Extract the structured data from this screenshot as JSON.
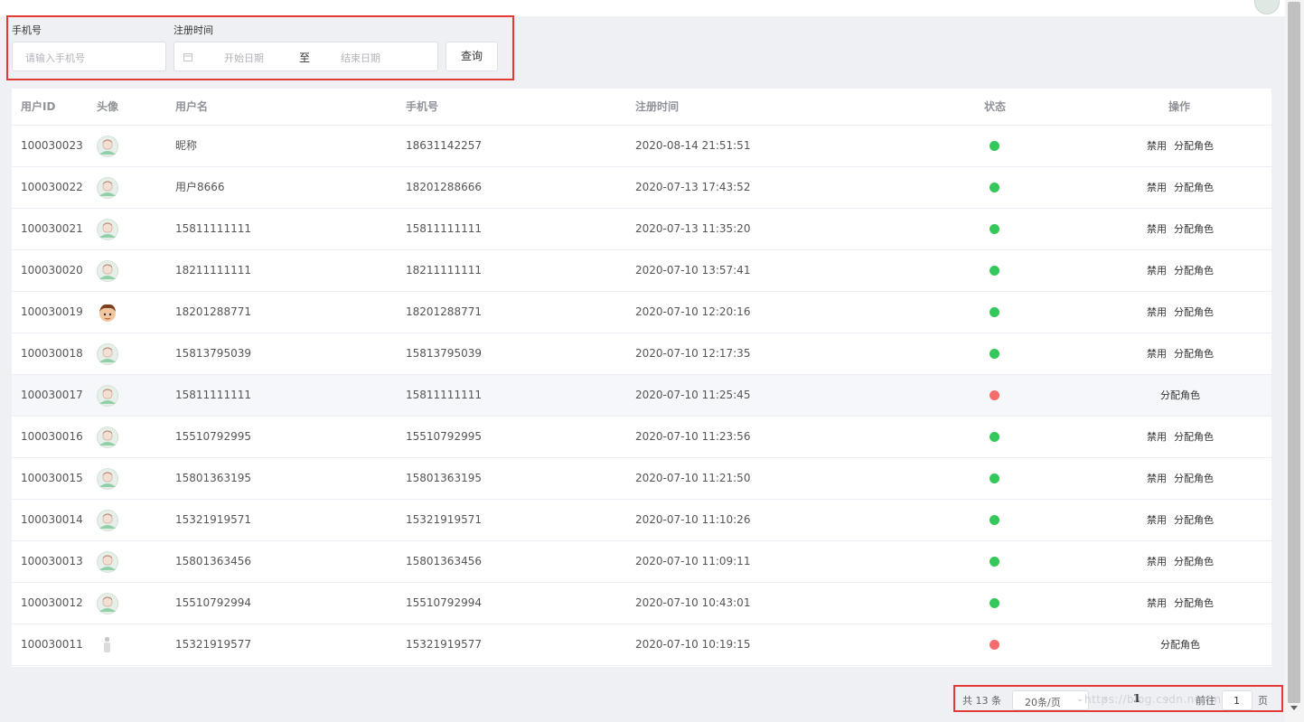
{
  "filters": {
    "phone_label": "手机号",
    "phone_placeholder": "请输入手机号",
    "date_label": "注册时间",
    "start_placeholder": "开始日期",
    "range_separator": "至",
    "end_placeholder": "结束日期",
    "query_button": "查询"
  },
  "table": {
    "headers": {
      "id": "用户ID",
      "avatar": "头像",
      "username": "用户名",
      "phone": "手机号",
      "reg_time": "注册时间",
      "status": "状态",
      "actions": "操作"
    },
    "rows": [
      {
        "id": "100030023",
        "username": "昵称",
        "phone": "18631142257",
        "reg_time": "2020-08-14 21:51:51",
        "avatar": "default",
        "status": "enabled",
        "status_color": "#34c759",
        "disable_label": "禁用",
        "assign_label": "分配角色"
      },
      {
        "id": "100030022",
        "username": "用户8666",
        "phone": "18201288666",
        "reg_time": "2020-07-13 17:43:52",
        "avatar": "default",
        "status": "enabled",
        "status_color": "#34c759",
        "disable_label": "禁用",
        "assign_label": "分配角色"
      },
      {
        "id": "100030021",
        "username": "15811111111",
        "phone": "15811111111",
        "reg_time": "2020-07-13 11:35:20",
        "avatar": "default",
        "status": "enabled",
        "status_color": "#34c759",
        "disable_label": "禁用",
        "assign_label": "分配角色"
      },
      {
        "id": "100030020",
        "username": "18211111111",
        "phone": "18211111111",
        "reg_time": "2020-07-10 13:57:41",
        "avatar": "default",
        "status": "enabled",
        "status_color": "#34c759",
        "disable_label": "禁用",
        "assign_label": "分配角色"
      },
      {
        "id": "100030019",
        "username": "18201288771",
        "phone": "18201288771",
        "reg_time": "2020-07-10 12:20:16",
        "avatar": "cartoon",
        "status": "enabled",
        "status_color": "#34c759",
        "disable_label": "禁用",
        "assign_label": "分配角色"
      },
      {
        "id": "100030018",
        "username": "15813795039",
        "phone": "15813795039",
        "reg_time": "2020-07-10 12:17:35",
        "avatar": "default",
        "status": "enabled",
        "status_color": "#34c759",
        "disable_label": "禁用",
        "assign_label": "分配角色"
      },
      {
        "id": "100030017",
        "username": "15811111111",
        "phone": "15811111111",
        "reg_time": "2020-07-10 11:25:45",
        "avatar": "default",
        "status": "disabled",
        "status_color": "#f56c6c",
        "disable_label": "",
        "assign_label": "分配角色"
      },
      {
        "id": "100030016",
        "username": "15510792995",
        "phone": "15510792995",
        "reg_time": "2020-07-10 11:23:56",
        "avatar": "default",
        "status": "enabled",
        "status_color": "#34c759",
        "disable_label": "禁用",
        "assign_label": "分配角色"
      },
      {
        "id": "100030015",
        "username": "15801363195",
        "phone": "15801363195",
        "reg_time": "2020-07-10 11:21:50",
        "avatar": "default",
        "status": "enabled",
        "status_color": "#34c759",
        "disable_label": "禁用",
        "assign_label": "分配角色"
      },
      {
        "id": "100030014",
        "username": "15321919571",
        "phone": "15321919571",
        "reg_time": "2020-07-10 11:10:26",
        "avatar": "default",
        "status": "enabled",
        "status_color": "#34c759",
        "disable_label": "禁用",
        "assign_label": "分配角色"
      },
      {
        "id": "100030013",
        "username": "15801363456",
        "phone": "15801363456",
        "reg_time": "2020-07-10 11:09:11",
        "avatar": "default",
        "status": "enabled",
        "status_color": "#34c759",
        "disable_label": "禁用",
        "assign_label": "分配角色"
      },
      {
        "id": "100030012",
        "username": "15510792994",
        "phone": "15510792994",
        "reg_time": "2020-07-10 10:43:01",
        "avatar": "default",
        "status": "enabled",
        "status_color": "#34c759",
        "disable_label": "禁用",
        "assign_label": "分配角色"
      },
      {
        "id": "100030011",
        "username": "15321919577",
        "phone": "15321919577",
        "reg_time": "2020-07-10 10:19:15",
        "avatar": "small-figure",
        "status": "disabled",
        "status_color": "#f56c6c",
        "disable_label": "",
        "assign_label": "分配角色"
      }
    ]
  },
  "pagination": {
    "total_text": "共 13 条",
    "page_size": "20条/页",
    "current_page": "1",
    "goto_label": "前往",
    "goto_value": "1",
    "page_suffix": "页"
  },
  "colors": {
    "highlight_border": "#e53935",
    "enabled": "#34c759",
    "disabled": "#f56c6c"
  }
}
